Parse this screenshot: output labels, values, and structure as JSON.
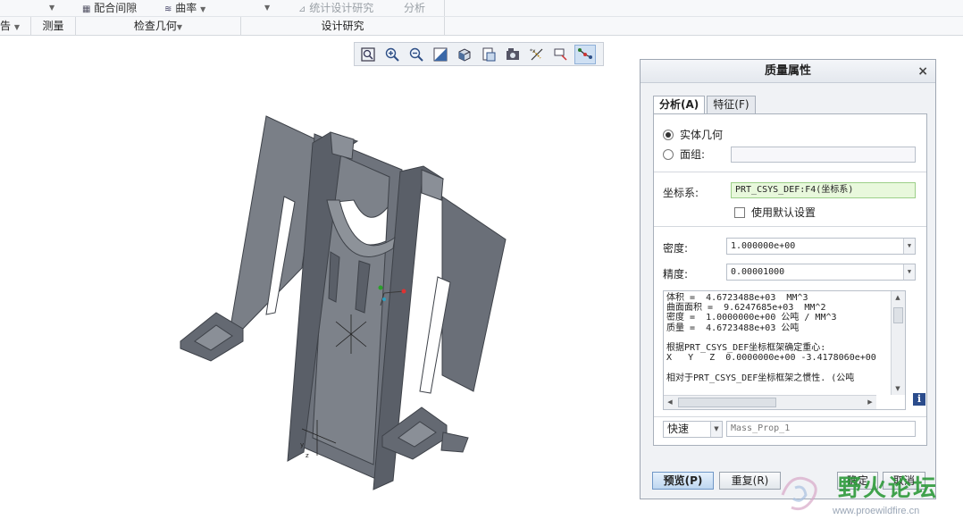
{
  "ribbon": {
    "top_items": {
      "fit_clearance": "配合间隙",
      "curvature": "曲率",
      "stat_design_study": "统计设计研究",
      "analysis": "分析"
    },
    "groups": {
      "left_partial": "告",
      "measure": "测量",
      "inspect_geometry": "检查几何",
      "design_study": "设计研究"
    }
  },
  "toolbar": {
    "buttons": [
      "refit-icon",
      "zoom-in-icon",
      "zoom-out-icon",
      "repaint-icon",
      "display-style-icon",
      "saved-orientations-icon",
      "view-manager-icon",
      "datum-display-icon",
      "annotation-display-icon",
      "spin-center-icon"
    ]
  },
  "dialog": {
    "title": "质量属性",
    "close": "×",
    "tabs": {
      "analysis": "分析(A)",
      "feature": "特征(F)"
    },
    "solid_geometry": "实体几何",
    "quilt": "面组:",
    "csys_label": "坐标系:",
    "csys_value": "PRT_CSYS_DEF:F4(坐标系)",
    "use_default": "使用默认设置",
    "density_label": "密度:",
    "density_value": "1.000000e+00",
    "accuracy_label": "精度:",
    "accuracy_value": "0.00001000",
    "results": [
      "体积 =  4.6723488e+03  MM^3",
      "曲面面积 =  9.6247685e+03  MM^2",
      "密度 =  1.0000000e+00 公吨 / MM^3",
      "质量 =  4.6723488e+03 公吨",
      "",
      "根据PRT_CSYS_DEF坐标框架确定重心:",
      "X   Y   Z  0.0000000e+00 -3.4178060e+00",
      "",
      "相对于PRT_CSYS_DEF坐标框架之惯性. (公吨"
    ],
    "mode_value": "快速",
    "feature_name": "Mass_Prop_1",
    "buttons": {
      "preview": "预览(P)",
      "repeat": "重复(R)",
      "ok": "确定",
      "cancel": "取消"
    }
  },
  "watermark": {
    "name": "野火论坛",
    "url": "www.proewildfire.cn"
  },
  "colors": {
    "model_face": "#6e737c",
    "model_dark": "#4f545c",
    "model_light": "#8a8f97",
    "watermark_green": "#2d9a3a"
  }
}
